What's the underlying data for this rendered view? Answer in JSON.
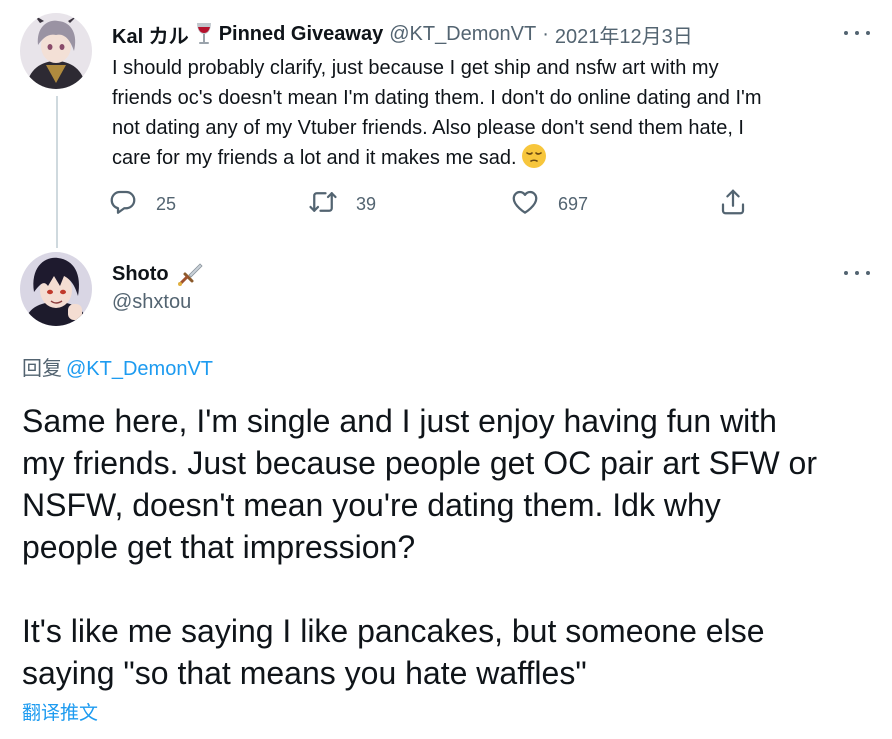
{
  "parent_tweet": {
    "author_name": "Kal カル",
    "name_emoji": "wine-glass-emoji",
    "pinned_label": "Pinned Giveaway",
    "handle": "@KT_DemonVT",
    "separator": "·",
    "date": "2021年12月3日",
    "text_lines": [
      "I should probably clarify, just because I get ship and nsfw art with my",
      "friends oc's doesn't mean I'm dating them. I don't do online dating and I'm",
      "not dating any of my Vtuber friends. Also please don't send them hate, I",
      "care for my friends a lot and it makes me sad."
    ],
    "trailing_emoji": "pensive-face-emoji",
    "reply_count": "25",
    "retweet_count": "39",
    "like_count": "697"
  },
  "main_tweet": {
    "author_name": "Shoto",
    "name_emoji": "dagger-emoji",
    "handle": "@shxtou",
    "replying_label": "回复",
    "replying_to": "@KT_DemonVT",
    "paragraph1_lines": [
      "Same here, I'm single and I just enjoy having fun with",
      "my friends. Just because people get OC pair art SFW or",
      "NSFW, doesn't mean you're dating them. Idk why",
      "people get that impression?"
    ],
    "paragraph2_lines": [
      "It's like me saying I like pancakes, but someone else",
      "saying \"so that means you hate waffles\""
    ],
    "translate_label": "翻译推文"
  },
  "colors": {
    "text": "#0f1419",
    "secondary": "#536471",
    "accent": "#1d9bf0",
    "thread_line": "#cfd9de"
  }
}
